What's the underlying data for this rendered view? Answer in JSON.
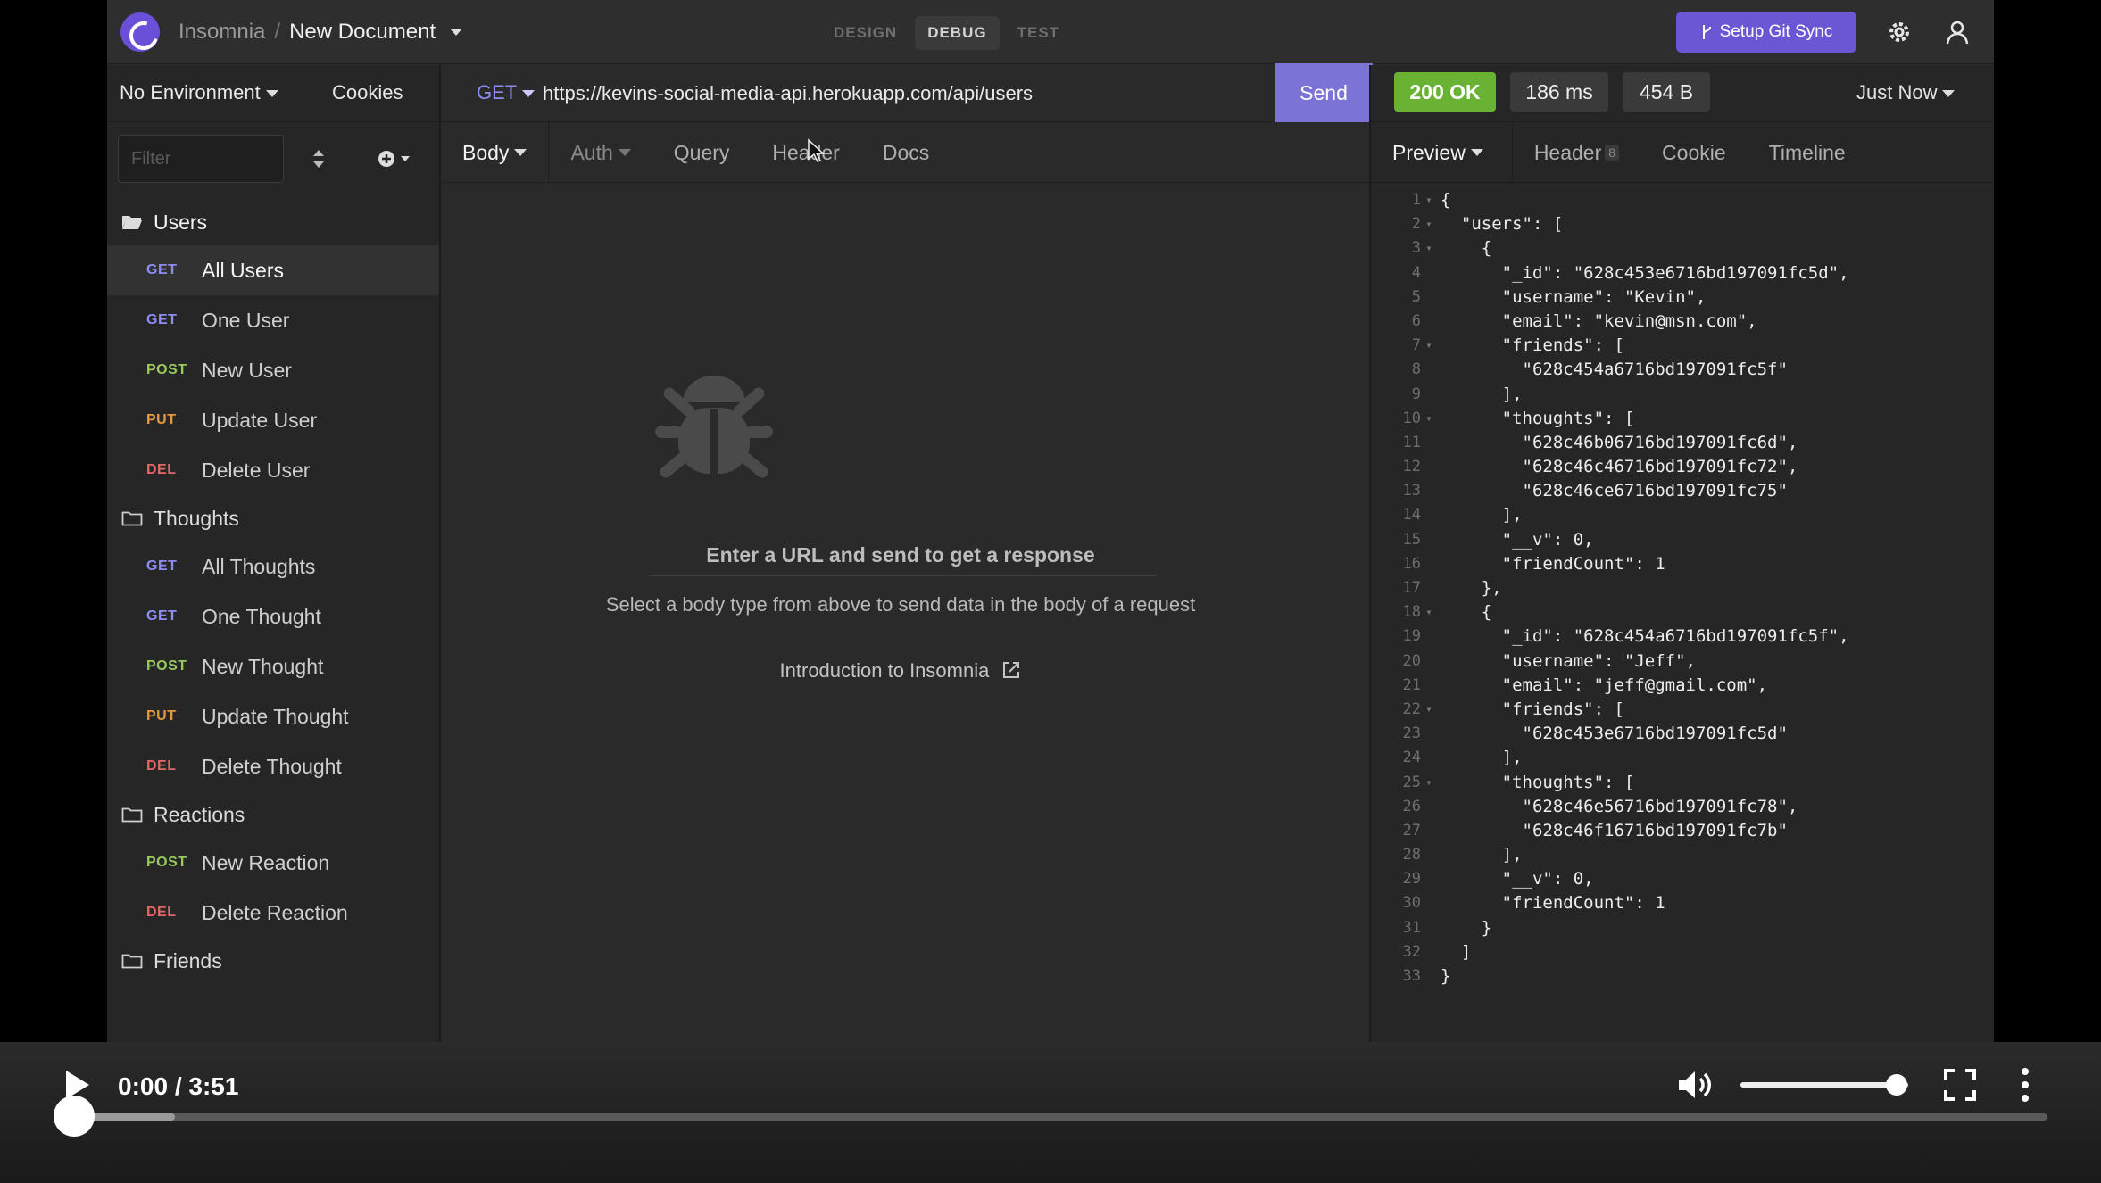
{
  "app": {
    "name": "Insomnia",
    "separator": "/",
    "document": "New Document",
    "modes": [
      "DESIGN",
      "DEBUG",
      "TEST"
    ],
    "active_mode": "DEBUG",
    "git_sync_label": "Setup Git Sync",
    "accent": "#6b57d4"
  },
  "sidebar": {
    "environment": "No Environment",
    "cookies": "Cookies",
    "filter_placeholder": "Filter",
    "folders": [
      {
        "name": "Users",
        "open": true,
        "requests": [
          {
            "method": "GET",
            "label": "All Users",
            "active": true
          },
          {
            "method": "GET",
            "label": "One User"
          },
          {
            "method": "POST",
            "label": "New User"
          },
          {
            "method": "PUT",
            "label": "Update User"
          },
          {
            "method": "DEL",
            "label": "Delete User"
          }
        ]
      },
      {
        "name": "Thoughts",
        "requests": [
          {
            "method": "GET",
            "label": "All Thoughts"
          },
          {
            "method": "GET",
            "label": "One Thought"
          },
          {
            "method": "POST",
            "label": "New Thought"
          },
          {
            "method": "PUT",
            "label": "Update Thought"
          },
          {
            "method": "DEL",
            "label": "Delete Thought"
          }
        ]
      },
      {
        "name": "Reactions",
        "requests": [
          {
            "method": "POST",
            "label": "New Reaction"
          },
          {
            "method": "DEL",
            "label": "Delete Reaction"
          }
        ]
      },
      {
        "name": "Friends",
        "requests": []
      }
    ]
  },
  "request": {
    "method": "GET",
    "url": "https://kevins-social-media-api.herokuapp.com/api/users",
    "send_label": "Send",
    "tabs": [
      "Body",
      "Auth",
      "Query",
      "Header",
      "Docs"
    ],
    "empty_title": "Enter a URL and send to get a response",
    "empty_hint": "Select a body type from above to send data in the body of a request",
    "intro_link": "Introduction to Insomnia"
  },
  "response": {
    "status": "200 OK",
    "time": "186 ms",
    "size": "454 B",
    "timestamp": "Just Now",
    "tabs": [
      "Preview",
      "Header",
      "Cookie",
      "Timeline"
    ],
    "header_count": "8",
    "status_color": "#6ab234",
    "lines": [
      {
        "n": "1",
        "fold": true,
        "text": "{"
      },
      {
        "n": "2",
        "fold": true,
        "text": "  \"users\": ["
      },
      {
        "n": "3",
        "fold": true,
        "text": "    {"
      },
      {
        "n": "4",
        "text": "      \"_id\": \"628c453e6716bd197091fc5d\","
      },
      {
        "n": "5",
        "text": "      \"username\": \"Kevin\","
      },
      {
        "n": "6",
        "text": "      \"email\": \"kevin@msn.com\","
      },
      {
        "n": "7",
        "fold": true,
        "text": "      \"friends\": ["
      },
      {
        "n": "8",
        "text": "        \"628c454a6716bd197091fc5f\""
      },
      {
        "n": "9",
        "text": "      ],"
      },
      {
        "n": "10",
        "fold": true,
        "text": "      \"thoughts\": ["
      },
      {
        "n": "11",
        "text": "        \"628c46b06716bd197091fc6d\","
      },
      {
        "n": "12",
        "text": "        \"628c46c46716bd197091fc72\","
      },
      {
        "n": "13",
        "text": "        \"628c46ce6716bd197091fc75\""
      },
      {
        "n": "14",
        "text": "      ],"
      },
      {
        "n": "15",
        "text": "      \"__v\": 0,"
      },
      {
        "n": "16",
        "text": "      \"friendCount\": 1"
      },
      {
        "n": "17",
        "text": "    },"
      },
      {
        "n": "18",
        "fold": true,
        "text": "    {"
      },
      {
        "n": "19",
        "text": "      \"_id\": \"628c454a6716bd197091fc5f\","
      },
      {
        "n": "20",
        "text": "      \"username\": \"Jeff\","
      },
      {
        "n": "21",
        "text": "      \"email\": \"jeff@gmail.com\","
      },
      {
        "n": "22",
        "fold": true,
        "text": "      \"friends\": ["
      },
      {
        "n": "23",
        "text": "        \"628c453e6716bd197091fc5d\""
      },
      {
        "n": "24",
        "text": "      ],"
      },
      {
        "n": "25",
        "fold": true,
        "text": "      \"thoughts\": ["
      },
      {
        "n": "26",
        "text": "        \"628c46e56716bd197091fc78\","
      },
      {
        "n": "27",
        "text": "        \"628c46f16716bd197091fc7b\""
      },
      {
        "n": "28",
        "text": "      ],"
      },
      {
        "n": "29",
        "text": "      \"__v\": 0,"
      },
      {
        "n": "30",
        "text": "      \"friendCount\": 1"
      },
      {
        "n": "31",
        "text": "    }"
      },
      {
        "n": "32",
        "text": "  ]"
      },
      {
        "n": "33",
        "text": "}"
      }
    ]
  },
  "player": {
    "time": "0:00 / 3:51",
    "progress": 0.0,
    "volume": 0.93
  }
}
